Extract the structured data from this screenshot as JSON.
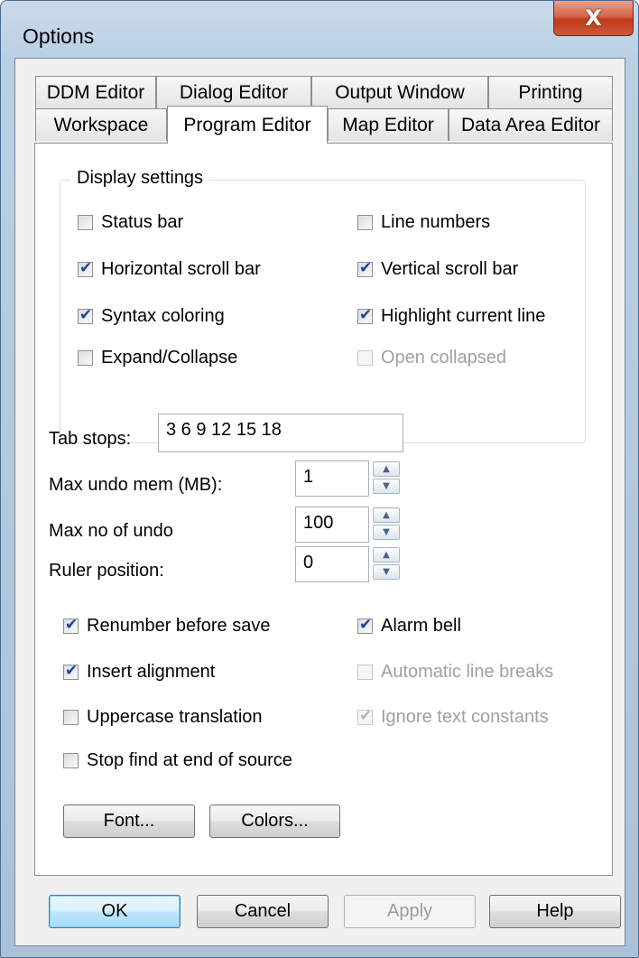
{
  "window": {
    "title": "Options",
    "close_glyph": "X"
  },
  "tabs_row1": [
    {
      "label": "DDM Editor"
    },
    {
      "label": "Dialog Editor"
    },
    {
      "label": "Output Window"
    },
    {
      "label": "Printing"
    }
  ],
  "tabs_row2": [
    {
      "label": "Workspace",
      "active": false
    },
    {
      "label": "Program Editor",
      "active": true
    },
    {
      "label": "Map Editor",
      "active": false
    },
    {
      "label": "Data Area Editor",
      "active": false
    }
  ],
  "display_settings": {
    "legend": "Display settings",
    "status_bar": {
      "label": "Status bar",
      "checked": false,
      "enabled": true
    },
    "line_numbers": {
      "label": "Line numbers",
      "checked": false,
      "enabled": true
    },
    "horizontal_scroll_bar": {
      "label": "Horizontal scroll bar",
      "checked": true,
      "enabled": true
    },
    "vertical_scroll_bar": {
      "label": "Vertical scroll bar",
      "checked": true,
      "enabled": true
    },
    "syntax_coloring": {
      "label": "Syntax coloring",
      "checked": true,
      "enabled": true
    },
    "highlight_current_line": {
      "label": "Highlight current line",
      "checked": true,
      "enabled": true
    },
    "expand_collapse": {
      "label": "Expand/Collapse",
      "checked": false,
      "enabled": true
    },
    "open_collapsed": {
      "label": "Open collapsed",
      "checked": false,
      "enabled": false
    }
  },
  "fields": {
    "tab_stops": {
      "label": "Tab stops:",
      "value": "3 6 9 12 15 18"
    },
    "max_undo_mem": {
      "label": "Max undo mem (MB):",
      "value": "1"
    },
    "max_no_of_undo": {
      "label": "Max no of undo",
      "value": "100"
    },
    "ruler_position": {
      "label": "Ruler position:",
      "value": "0"
    }
  },
  "options": {
    "renumber_before_save": {
      "label": "Renumber before save",
      "checked": true,
      "enabled": true
    },
    "alarm_bell": {
      "label": "Alarm bell",
      "checked": true,
      "enabled": true
    },
    "insert_alignment": {
      "label": "Insert alignment",
      "checked": true,
      "enabled": true
    },
    "automatic_line_breaks": {
      "label": "Automatic line breaks",
      "checked": false,
      "enabled": false
    },
    "uppercase_translation": {
      "label": "Uppercase translation",
      "checked": false,
      "enabled": true
    },
    "ignore_text_constants": {
      "label": "Ignore text constants",
      "checked": true,
      "enabled": false
    },
    "stop_find_at_end_of_source": {
      "label": "Stop find at end of source",
      "checked": false,
      "enabled": true
    }
  },
  "panel_buttons": {
    "font": "Font...",
    "colors": "Colors..."
  },
  "dialog_buttons": {
    "ok": "OK",
    "cancel": "Cancel",
    "apply": "Apply",
    "help": "Help"
  },
  "icons": {
    "close": "close-icon",
    "spin_up": "spin-up-icon",
    "spin_down": "spin-down-icon",
    "check": "checkmark-icon"
  },
  "colors": {
    "title_bar": "#b9cfe4",
    "close_button": "#c2391a",
    "check_mark": "#23419a",
    "default_button_border": "#3c7fb1"
  }
}
